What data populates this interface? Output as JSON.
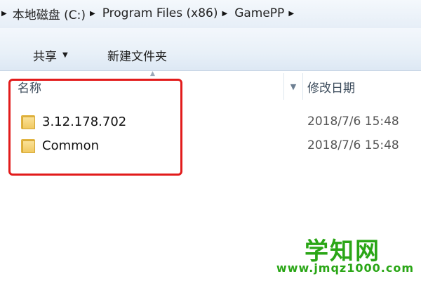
{
  "address": {
    "crumbs": [
      "本地磁盘 (C:)",
      "Program Files (x86)",
      "GamePP"
    ]
  },
  "toolbar": {
    "share_label": "共享",
    "new_folder_label": "新建文件夹"
  },
  "columns": {
    "name": "名称",
    "date_modified": "修改日期"
  },
  "files": [
    {
      "name": "3.12.178.702",
      "modified": "2018/7/6 15:48",
      "icon": "folder-icon"
    },
    {
      "name": "Common",
      "modified": "2018/7/6 15:48",
      "icon": "folder-icon"
    }
  ],
  "watermark": {
    "title": "学知网",
    "url": "www.jmqz1000.com"
  },
  "colors": {
    "highlight": "#e21b1b",
    "watermark": "#2aa616"
  }
}
